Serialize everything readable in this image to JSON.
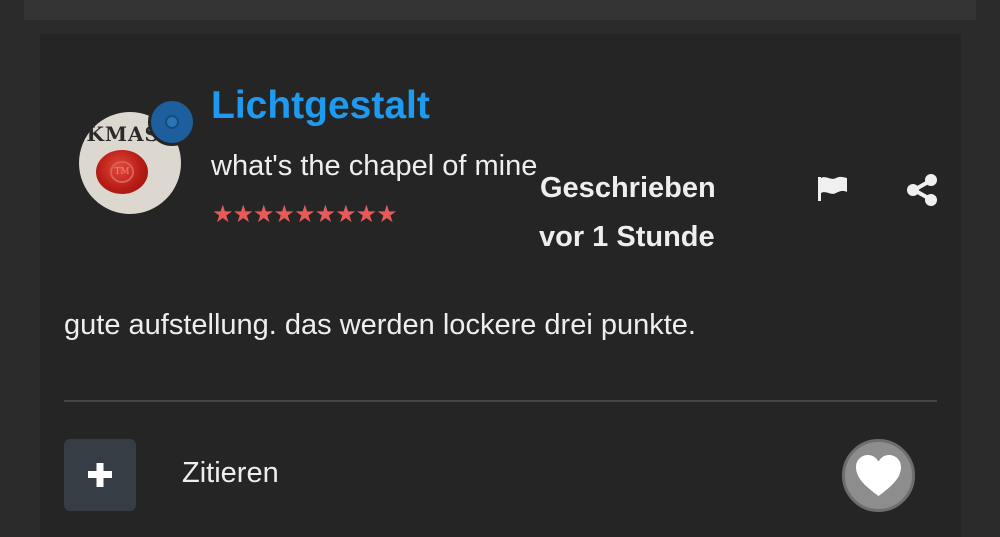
{
  "post": {
    "author": {
      "name": "Lichtgestalt",
      "title": "what's the chapel of mine",
      "avatar_text": "SKMAS",
      "avatar_seal_text": "TM",
      "rank_stars": "★★★★★★★★★"
    },
    "meta": {
      "written_label": "Geschrieben",
      "time_label": "vor 1 Stunde"
    },
    "body": "gute aufstellung. das werden lockere drei punkte.",
    "actions": {
      "quote_label": "Zitieren",
      "plus_icon": "plus-icon",
      "flag_icon": "flag-icon",
      "share_icon": "share-icon",
      "like_icon": "heart-icon"
    }
  },
  "colors": {
    "username": "#1e9bf0",
    "text": "#eeeeee",
    "card_bg": "#252525",
    "page_bg": "#2b2b2b",
    "stars": "#e85a5a",
    "plus_button_bg": "#363d45",
    "like_button_bg": "#8d8d8d",
    "status_dot": "#1d5f9c"
  }
}
